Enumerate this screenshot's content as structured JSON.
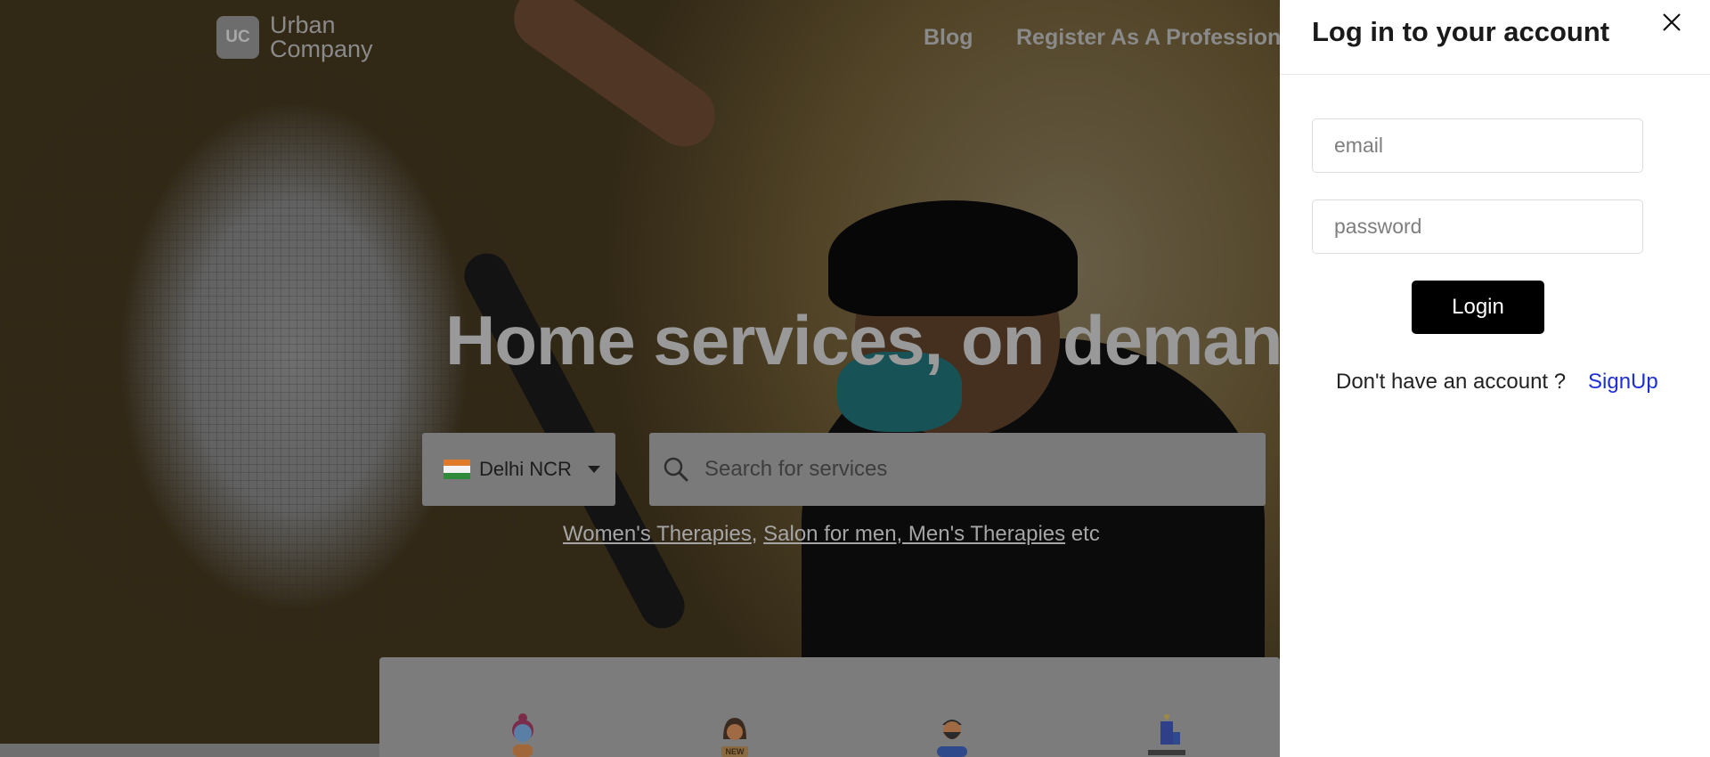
{
  "header": {
    "logo_mark": "UC",
    "logo_line1": "Urban",
    "logo_line2": "Company",
    "nav": [
      "Blog",
      "Register As A Professiona"
    ]
  },
  "hero": {
    "headline": "Home services, on demand.",
    "city": "Delhi NCR",
    "search_placeholder": "Search for services",
    "suggestions": [
      "Women's Therapies",
      "Salon for men, Men's Therapies"
    ],
    "suggestions_sep": ",",
    "suggestions_suffix": "etc"
  },
  "categories": {
    "icons": [
      "spa-woman-icon",
      "new-service-woman-icon",
      "bearded-man-icon",
      "candle-spa-icon"
    ],
    "new_badge": "NEW"
  },
  "login": {
    "title": "Log in to your account",
    "email_placeholder": "email",
    "password_placeholder": "password",
    "login_label": "Login",
    "no_account_text": "Don't have an account ?",
    "signup_label": "SignUp"
  },
  "colors": {
    "signup_link": "#1d2fd6",
    "login_button": "#000000"
  }
}
